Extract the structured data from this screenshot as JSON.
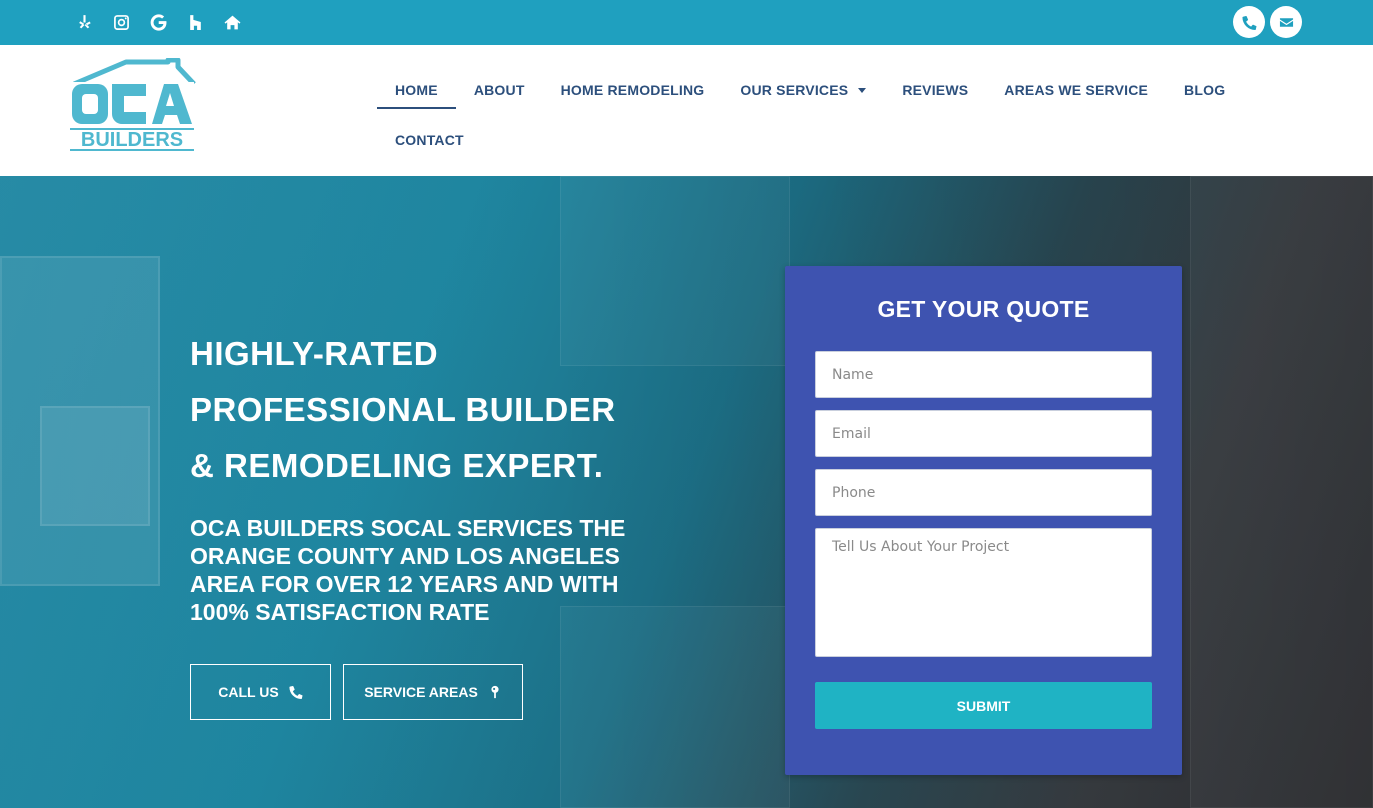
{
  "topbar": {
    "social_icons": [
      "yelp-icon",
      "instagram-icon",
      "google-icon",
      "houzz-icon",
      "home-icon"
    ],
    "contact_icons": [
      "phone-icon",
      "envelope-icon"
    ],
    "colors": {
      "bar": "#1fa0bf"
    }
  },
  "header": {
    "logo": {
      "line1": "OCA",
      "line2": "BUILDERS",
      "color": "#4fb8cf"
    },
    "nav": [
      {
        "label": "HOME",
        "active": true
      },
      {
        "label": "ABOUT"
      },
      {
        "label": "HOME REMODELING"
      },
      {
        "label": "OUR SERVICES",
        "has_dropdown": true
      },
      {
        "label": "REVIEWS"
      },
      {
        "label": "AREAS WE SERVICE"
      },
      {
        "label": "BLOG"
      },
      {
        "label": "CONTACT"
      }
    ],
    "nav_color": "#2c4f7c"
  },
  "hero": {
    "headline": [
      "HIGHLY-RATED",
      "PROFESSIONAL BUILDER",
      "& REMODELING EXPERT."
    ],
    "subhead": [
      "OCA BUILDERS SOCAL SERVICES THE",
      "ORANGE COUNTY AND LOS ANGELES",
      "AREA FOR OVER 12 YEARS AND WITH",
      "100% SATISFACTION RATE"
    ],
    "buttons": [
      {
        "label": "CALL US",
        "icon": "phone-icon"
      },
      {
        "label": "SERVICE AREAS",
        "icon": "map-pin-icon"
      }
    ]
  },
  "quote_form": {
    "title": "GET YOUR QUOTE",
    "fields": {
      "name": {
        "placeholder": "Name",
        "value": ""
      },
      "email": {
        "placeholder": "Email",
        "value": ""
      },
      "phone": {
        "placeholder": "Phone",
        "value": ""
      },
      "message": {
        "placeholder": "Tell Us About Your Project",
        "value": ""
      }
    },
    "submit_label": "SUBMIT",
    "colors": {
      "panel": "#3e53b0",
      "submit": "#1fb3c4"
    }
  }
}
